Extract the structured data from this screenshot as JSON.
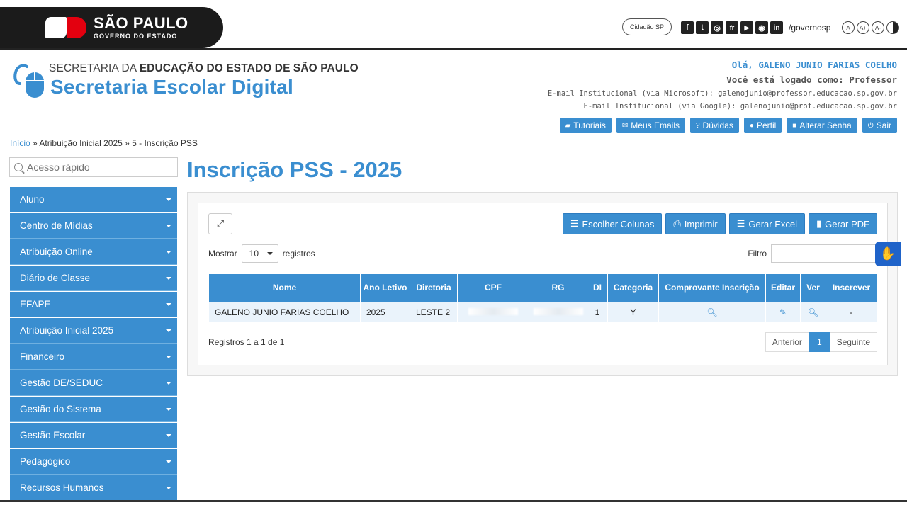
{
  "gov": {
    "brand_title": "SÃO PAULO",
    "brand_subtitle": "GOVERNO DO ESTADO",
    "cidadao_label": "Cidadão SP",
    "social_icons": [
      "facebook-icon",
      "twitter-icon",
      "instagram-icon",
      "flickr-icon",
      "youtube-icon",
      "issuu-icon",
      "linkedin-icon"
    ],
    "social_glyphs": [
      "f",
      "t",
      "◎",
      "fr",
      "▶",
      "◉",
      "in"
    ],
    "handle": "/governosp",
    "a11y": [
      "A",
      "A+",
      "A-"
    ]
  },
  "header": {
    "sec_prefix": "SECRETARIA DA ",
    "sec_bold": "EDUCAÇÃO DO ESTADO DE SÃO PAULO",
    "app_name": "Secretaria Escolar Digital",
    "greeting": "Olá, GALENO JUNIO FARIAS COELHO",
    "role": "Você está logado como: Professor",
    "email_ms": "E-mail Institucional (via Microsoft): galenojunio@professor.educacao.sp.gov.br",
    "email_google": "E-mail Institucional (via Google): galenojunio@prof.educacao.sp.gov.br",
    "buttons": [
      "Tutoriais",
      "Meus Emails",
      "Dúvidas",
      "Perfil",
      "Alterar Senha",
      "Sair"
    ]
  },
  "breadcrumb": {
    "home": "Início",
    "sep": "»",
    "level1": "Atribuição Inicial 2025",
    "level2": "5 - Inscrição PSS"
  },
  "sidebar": {
    "search_placeholder": "Acesso rápido",
    "items": [
      "Aluno",
      "Centro de Mídias",
      "Atribuição Online",
      "Diário de Classe",
      "EFAPE",
      "Atribuição Inicial 2025",
      "Financeiro",
      "Gestão DE/SEDUC",
      "Gestão do Sistema",
      "Gestão Escolar",
      "Pedagógico",
      "Recursos Humanos"
    ]
  },
  "main": {
    "title": "Inscrição PSS - 2025",
    "actions": [
      "Escolher Colunas",
      "Imprimir",
      "Gerar Excel",
      "Gerar PDF"
    ],
    "show_label": "Mostrar",
    "show_value": "10",
    "records_label": "registros",
    "filter_label": "Filtro",
    "table": {
      "headers": [
        "Nome",
        "Ano Letivo",
        "Diretoria",
        "CPF",
        "RG",
        "DI",
        "Categoria",
        "Comprovante Inscrição",
        "Editar",
        "Ver",
        "Inscrever"
      ],
      "rows": [
        {
          "nome": "GALENO JUNIO FARIAS COELHO",
          "ano": "2025",
          "diretoria": "LESTE 2",
          "di": "1",
          "categoria": "Y",
          "inscrever": "-"
        }
      ]
    },
    "records_info": "Registros 1 a 1 de 1",
    "pager": {
      "prev": "Anterior",
      "current": "1",
      "next": "Seguinte"
    }
  },
  "colors": {
    "accent": "#3a8ed0",
    "vlibras": "#1f63c9",
    "brand_red": "#e3000f"
  }
}
